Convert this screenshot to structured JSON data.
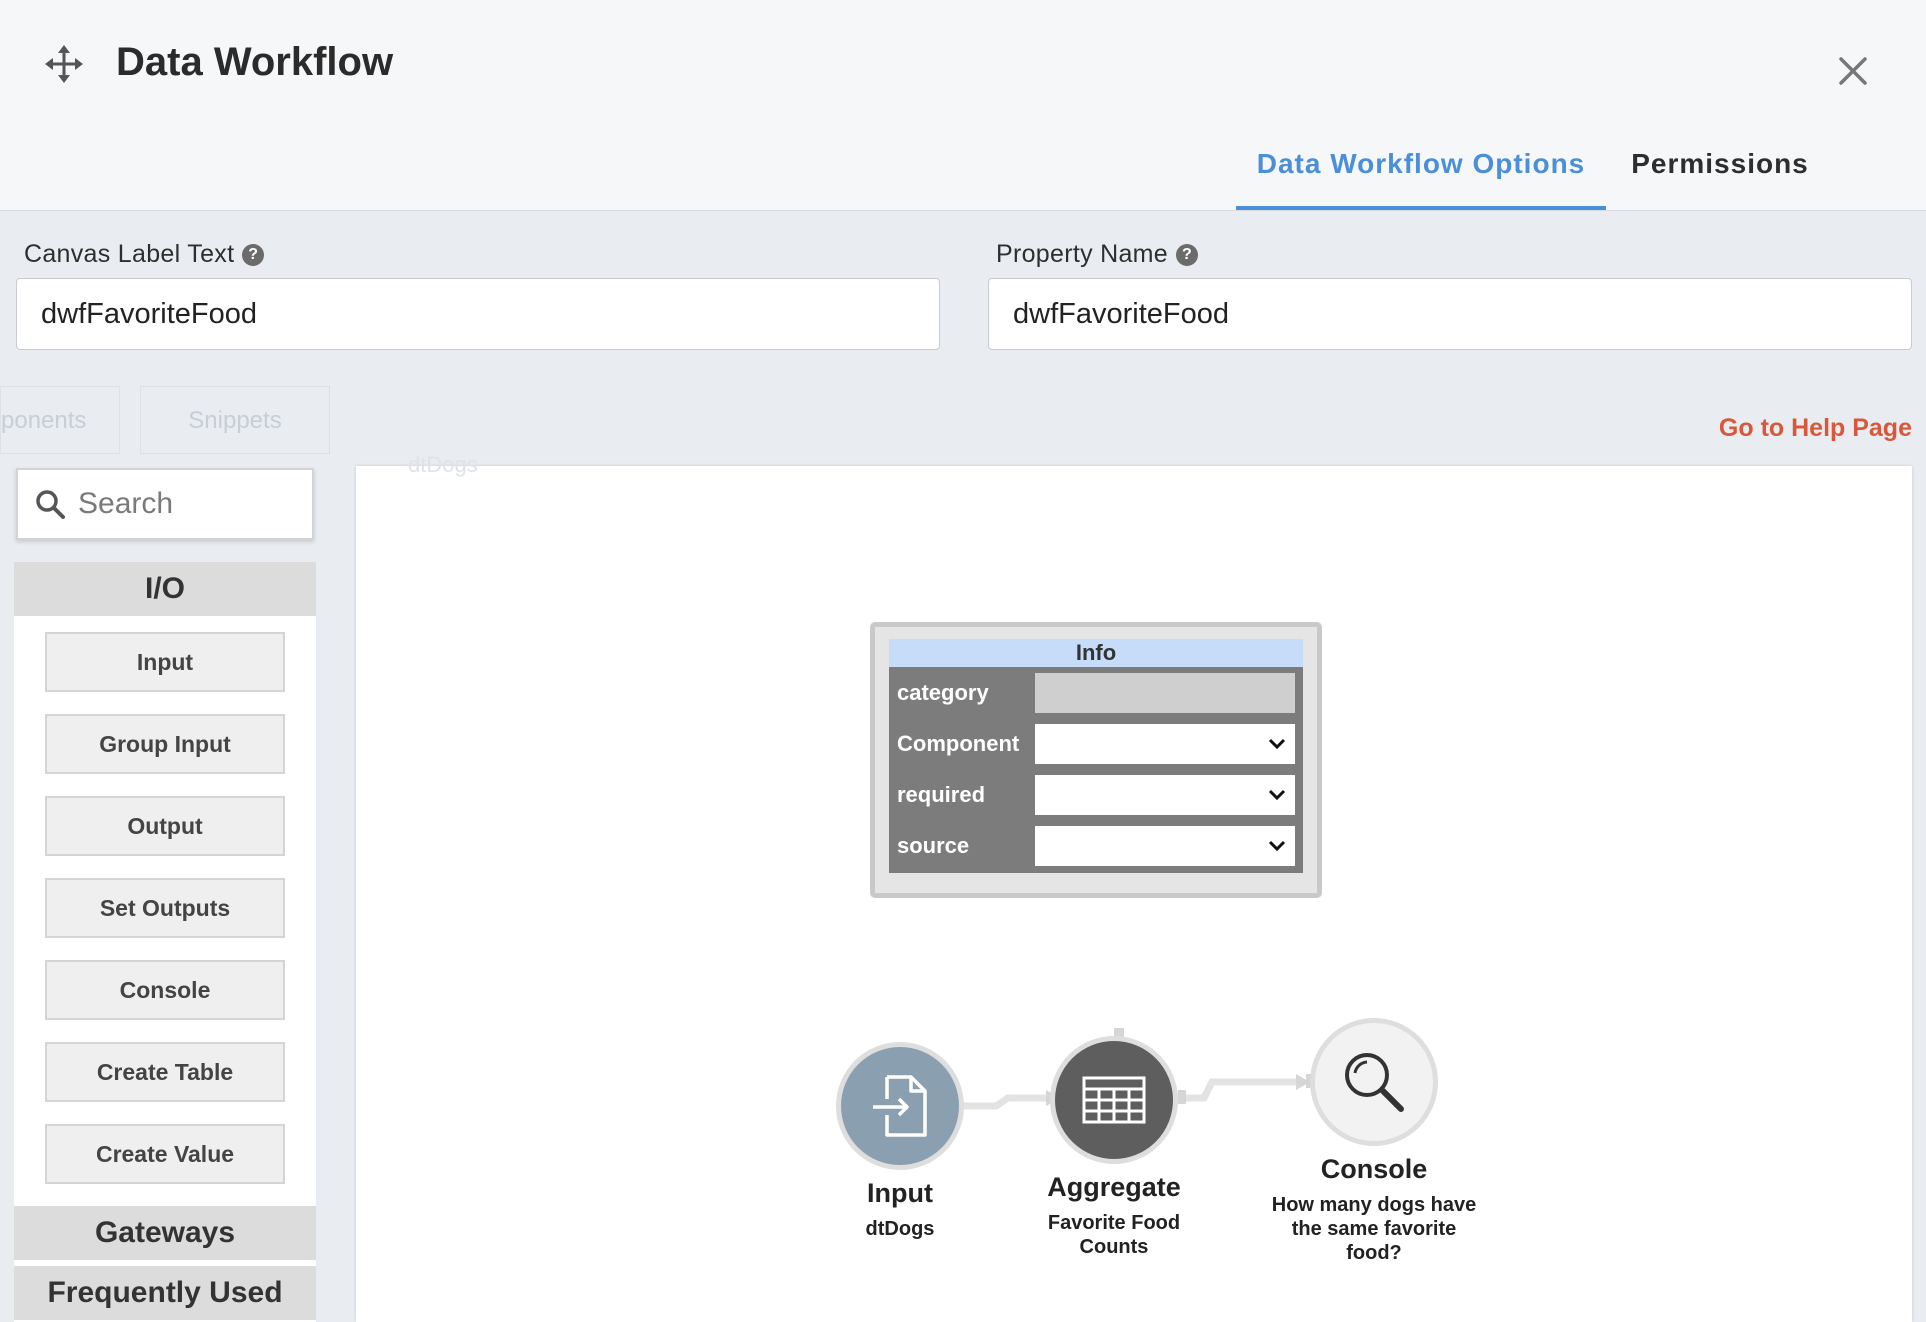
{
  "header": {
    "title": "Data Workflow",
    "tabs": [
      "Data Workflow Options",
      "Permissions"
    ]
  },
  "form": {
    "canvas_label": "Canvas Label Text",
    "canvas_value": "dwfFavoriteFood",
    "property_label": "Property Name",
    "property_value": "dwfFavoriteFood",
    "help_link": "Go to Help Page"
  },
  "background": {
    "tab_components": "ponents",
    "tab_snippets": "Snippets",
    "canvas_ghost": "dtDogs"
  },
  "palette": {
    "search_placeholder": "Search",
    "io_header": "I/O",
    "io_items": [
      "Input",
      "Group Input",
      "Output",
      "Set Outputs",
      "Console",
      "Create Table",
      "Create Value"
    ],
    "gateways_header": "Gateways",
    "frequent_header": "Frequently Used"
  },
  "info_panel": {
    "title": "Info",
    "rows": [
      "category",
      "Component",
      "required",
      "source"
    ]
  },
  "nodes": [
    {
      "title": "Input",
      "subtitle": "dtDogs"
    },
    {
      "title": "Aggregate",
      "subtitle": "Favorite Food Counts"
    },
    {
      "title": "Console",
      "subtitle": "How many dogs have the same favorite food?"
    }
  ],
  "colors": {
    "accent": "#4a8fd8",
    "help_link": "#d9583b",
    "input_node": "#8a9fb0",
    "aggregate_node": "#5e5e5e",
    "console_node": "#f2f2f2"
  }
}
